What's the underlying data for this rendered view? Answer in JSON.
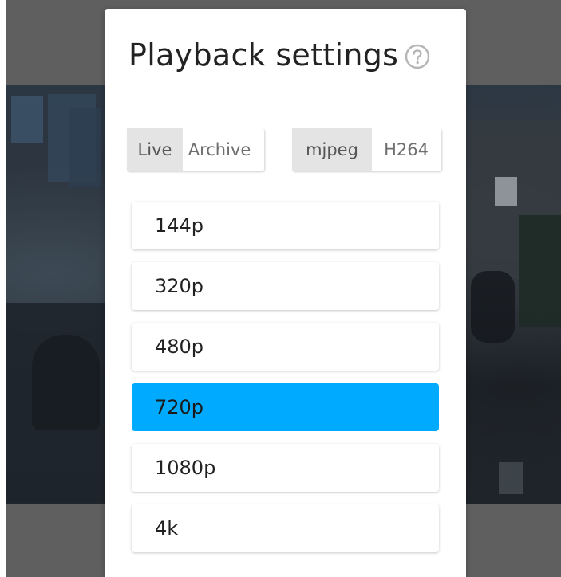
{
  "modal": {
    "title": "Playback settings",
    "help_icon": "help-circle-icon"
  },
  "mode_toggle": {
    "options": [
      "Live",
      "Archive"
    ],
    "selected": "Live"
  },
  "codec_toggle": {
    "options": [
      "mjpeg",
      "H264"
    ],
    "selected": "mjpeg"
  },
  "resolutions": {
    "items": [
      "144p",
      "320p",
      "480p",
      "720p",
      "1080p",
      "4k"
    ],
    "selected": "720p"
  },
  "colors": {
    "accent": "#00aaff",
    "segment_selected_bg": "#e4e4e4",
    "backdrop": "#5f5f5f"
  }
}
